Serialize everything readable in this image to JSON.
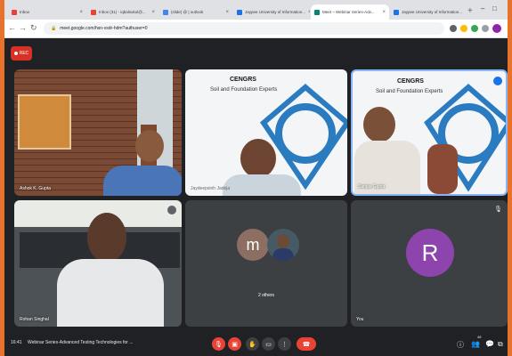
{
  "browser": {
    "tabs": [
      {
        "label": "Inbox",
        "color": "#ea4335"
      },
      {
        "label": "Inbox (31) - iqbalsukul@...",
        "color": "#ea4335"
      },
      {
        "label": "(slide) @ | outlook",
        "color": "#4285f4"
      },
      {
        "label": "Jaypee University of Information...",
        "color": "#1a73e8"
      },
      {
        "label": "Meet – Webinar Series-Adv...",
        "color": "#00897b"
      },
      {
        "label": "Jaypee University of Information...",
        "color": "#1a73e8"
      }
    ],
    "url": "meet.google.com/hsn-vsdr-hdm?authuser=0"
  },
  "rec": {
    "label": "REC"
  },
  "tiles": {
    "ashok": {
      "name": "Ashok K. Gupta"
    },
    "ceg1": {
      "logo_title": "CENGRS",
      "logo_subtitle": "Soil and Foundation Experts",
      "name": "Jaydeepsinh Jadeja"
    },
    "sanjay": {
      "logo_title": "CENGRS",
      "logo_subtitle": "Soil and Foundation Experts",
      "name": "Sanjay Gupta"
    },
    "rohan": {
      "name": "Rohan Singhal"
    },
    "others": {
      "avatar_letter": "m",
      "label": "2 others"
    },
    "you": {
      "avatar_letter": "R",
      "name": "You"
    }
  },
  "bottom": {
    "time": "16:41",
    "meeting_title": "Webinar Series-Advanced Testing Technologies for ...",
    "participants_count": "48"
  }
}
